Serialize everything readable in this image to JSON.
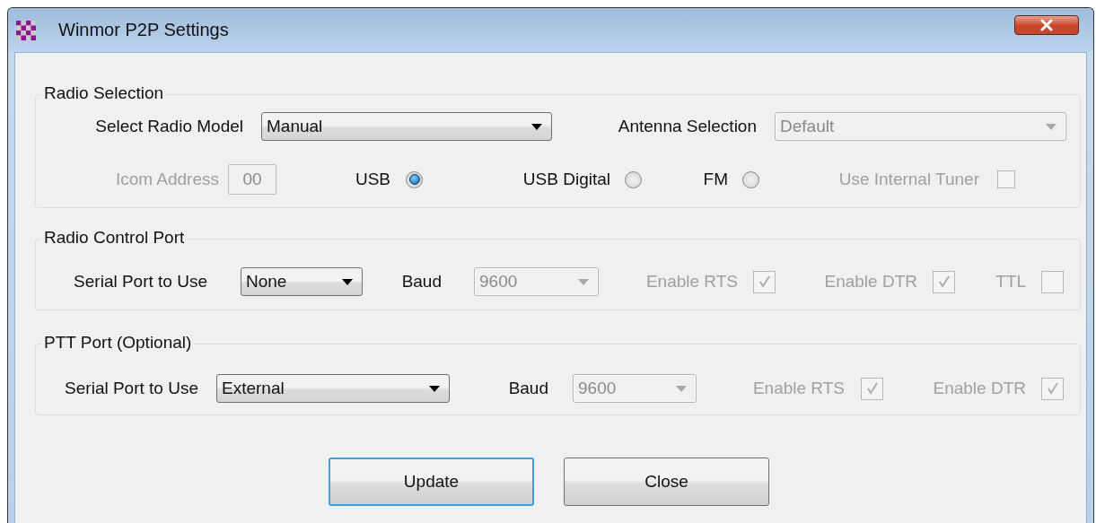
{
  "window": {
    "title": "Winmor P2P Settings"
  },
  "groups": [
    {
      "title": "Radio Selection",
      "lines": [
        {
          "controls": [
            {
              "kind": "combo",
              "label": "Select Radio Model",
              "value": "Manual",
              "disabled": false
            },
            {
              "kind": "combo",
              "label": "Antenna Selection",
              "value": "Default",
              "disabled": true
            }
          ]
        },
        {
          "controls": [
            {
              "kind": "field",
              "label": "Icom Address",
              "value": "00",
              "disabled": true
            },
            {
              "kind": "radio",
              "label": "USB",
              "selected": true
            },
            {
              "kind": "radio",
              "label": "USB Digital",
              "selected": false
            },
            {
              "kind": "radio",
              "label": "FM",
              "selected": false
            },
            {
              "kind": "checkbox",
              "label": "Use Internal Tuner",
              "checked": false,
              "disabled": true
            }
          ]
        }
      ]
    },
    {
      "title": "Radio Control Port",
      "lines": [
        {
          "controls": [
            {
              "kind": "combo",
              "label": "Serial Port to Use",
              "value": "None",
              "disabled": false
            },
            {
              "kind": "combo",
              "label": "Baud",
              "value": "9600",
              "disabled": true
            },
            {
              "kind": "checkbox",
              "label": "Enable RTS",
              "checked": true,
              "disabled": true
            },
            {
              "kind": "checkbox",
              "label": "Enable DTR",
              "checked": true,
              "disabled": true
            },
            {
              "kind": "checkbox",
              "label": "TTL",
              "checked": false,
              "disabled": true
            }
          ]
        }
      ]
    },
    {
      "title": "PTT Port (Optional)",
      "lines": [
        {
          "controls": [
            {
              "kind": "combo",
              "label": "Serial Port to Use",
              "value": "External",
              "disabled": false
            },
            {
              "kind": "combo",
              "label": "Baud",
              "value": "9600",
              "disabled": true
            },
            {
              "kind": "checkbox",
              "label": "Enable RTS",
              "checked": true,
              "disabled": true
            },
            {
              "kind": "checkbox",
              "label": "Enable DTR",
              "checked": true,
              "disabled": true
            }
          ]
        }
      ]
    }
  ],
  "buttons": [
    {
      "label": "Update",
      "focused": true
    },
    {
      "label": "Close",
      "focused": false
    }
  ]
}
